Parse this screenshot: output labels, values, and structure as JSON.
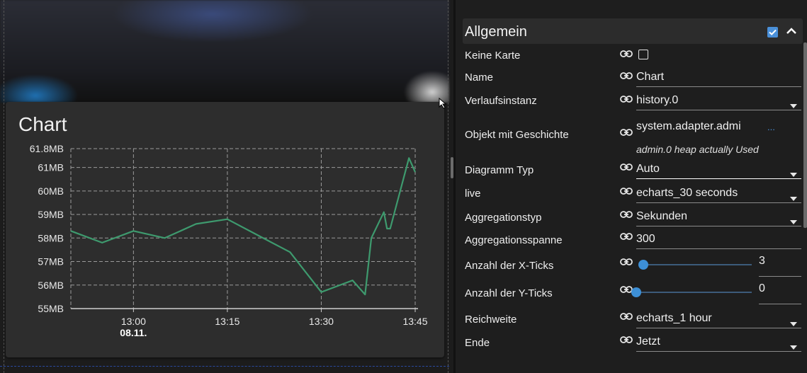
{
  "chart_card": {
    "title": "Chart"
  },
  "chart_data": {
    "type": "line",
    "title": "Chart",
    "x_ticks": [
      "13:00",
      "13:15",
      "13:30",
      "13:45"
    ],
    "x_subtick": "08.11.",
    "y_ticks": [
      "61.8MB",
      "61MB",
      "60MB",
      "59MB",
      "58MB",
      "57MB",
      "56MB",
      "55MB"
    ],
    "ylim": [
      55,
      61.8
    ],
    "y_unit": "MB",
    "grid": true,
    "line_color": "#3e9a6e",
    "series": [
      {
        "x": [
          "12:50",
          "12:55",
          "13:00",
          "13:05",
          "13:10",
          "13:15",
          "13:20",
          "13:25",
          "13:30",
          "13:35",
          "13:37",
          "13:38",
          "13:40",
          "13:40:30",
          "13:41",
          "13:44",
          "13:45"
        ],
        "values": [
          58.3,
          57.8,
          58.3,
          58.0,
          58.6,
          58.8,
          58.1,
          57.4,
          55.7,
          56.2,
          55.6,
          58.0,
          59.1,
          58.4,
          58.4,
          61.4,
          60.8
        ]
      }
    ]
  },
  "panel": {
    "group_title": "Allgemein",
    "group_checked": true,
    "accent": "#4a90d9",
    "rows": {
      "no_card": {
        "label": "Keine Karte"
      },
      "name": {
        "label": "Name",
        "value": "Chart"
      },
      "history_instance": {
        "label": "Verlaufsinstanz",
        "value": "history.0"
      },
      "object": {
        "label": "Objekt mit Geschichte",
        "value": "system.adapter.admi",
        "more": "...",
        "hint": "admin.0 heap actually Used"
      },
      "chart_type": {
        "label": "Diagramm Typ",
        "value": "Auto"
      },
      "live": {
        "label": "live",
        "value": "echarts_30 seconds"
      },
      "aggregation_type": {
        "label": "Aggregationstyp",
        "value": "Sekunden"
      },
      "aggregation_span": {
        "label": "Aggregationsspanne",
        "value": "300"
      },
      "x_ticks": {
        "label": "Anzahl der X-Ticks",
        "value": "3",
        "slider_fraction": 0.0
      },
      "y_ticks": {
        "label": "Anzahl der Y-Ticks",
        "value": "0",
        "slider_fraction": 0.0
      },
      "range": {
        "label": "Reichweite",
        "value": "echarts_1 hour"
      },
      "end": {
        "label": "Ende",
        "value": "Jetzt"
      }
    }
  },
  "icons": {
    "link": "link-icon",
    "dropdown": "chevron-down-icon",
    "collapse": "chevron-up-icon",
    "cursor": "cursor-arrow-icon"
  }
}
